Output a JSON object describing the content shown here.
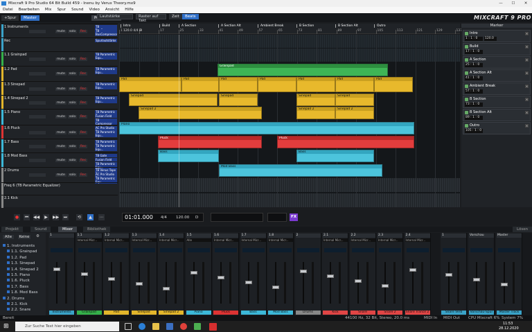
{
  "window": {
    "title": "Mixcraft 9 Pro Studio 64 Bit Build 459 - Inenu by Verux Theory.mx9"
  },
  "menu": [
    "Datei",
    "Bearbeiten",
    "Mix",
    "Spur",
    "Sound",
    "Video",
    "Ansicht",
    "Hilfe"
  ],
  "toolbar": {
    "volume_dd": "Lautstärke",
    "snap_dd": "Raster auf Takt",
    "time_btn": "Zeit",
    "beats_btn": "Beats",
    "logo": "MIXCRAFT 9 PRO"
  },
  "trackhdr": {
    "add_btn": "+Spur",
    "master_btn": "Master",
    "perf_btn": "Performance"
  },
  "ruler": {
    "ticks": [
      "1",
      "9",
      "17",
      "25",
      "33",
      "41",
      "49",
      "57",
      "65",
      "73",
      "81",
      "89",
      "97",
      "105",
      "113",
      "121",
      "129",
      "137"
    ],
    "markers": [
      "Intro",
      "Build",
      "A Section",
      "A Section Alt",
      "Ambient Break",
      "B Section",
      "B Section Alt",
      "Outro"
    ],
    "tempo": "120.0 4/4 B"
  },
  "tracks": [
    {
      "name": "1 Instruments",
      "fx": [
        "TB BusCompressor",
        "TB BusCompressor"
      ],
      "color": "#3aa3c8"
    },
    {
      "name": "Rec",
      "fx": [
        "Spurlautstärke"
      ],
      "color": "#3aa3c8"
    },
    {
      "name": "1.1 Grainpad",
      "fx": [
        "TB Parametric Equ..."
      ],
      "color": "#35b04a"
    },
    {
      "name": "1.2 Pad",
      "fx": [
        "TB Parametric Equ..."
      ],
      "color": "#e2b52b"
    },
    {
      "name": "1.3 Sinepad",
      "fx": [
        "TB Parametric Equ..."
      ],
      "color": "#e2b52b"
    },
    {
      "name": "1.4 Sinepad 2",
      "fx": [
        "TB Parametric Equ..."
      ],
      "color": "#e2b52b"
    },
    {
      "name": "1.5 Piano",
      "fx": [
        "TB Parametric Equ...",
        "Fusion Field",
        "TB Compressor"
      ],
      "color": "#3cb8d8"
    },
    {
      "name": "1.6 Pluck",
      "fx": [
        "AC Pro Studio Reve...",
        "TB Parametric Equ..."
      ],
      "color": "#d33"
    },
    {
      "name": "1.7 Bass",
      "fx": [
        "TB Parametric Equ...",
        "TB Parametric Equ..."
      ],
      "color": "#3cb8d8"
    },
    {
      "name": "1.8 Mod Bass",
      "fx": [
        "TB Gate",
        "Fusion Field",
        "TB Parametric Equ..."
      ],
      "color": "#3cb8d8"
    },
    {
      "name": "2 Drums",
      "fx": [
        "TB Venus Tape Emu...",
        "AC Pro Studio Reve...",
        "TB Parametric Equ..."
      ],
      "color": "#888"
    },
    {
      "name": "Freq 6 (TB Parametric Equalizer)",
      "fx": [],
      "color": "#888"
    },
    {
      "name": "2.1 Kick",
      "fx": [],
      "color": "#888"
    }
  ],
  "track_btns": {
    "mute": "mute",
    "solo": "solo",
    "rec": "Rec"
  },
  "clips": {
    "grainpad": "Grainpad",
    "pad": "Pad",
    "sinepad": "Sinepad",
    "sinepad2": "Sinepad 2",
    "piano": "Piano",
    "pluck": "Pluck",
    "bass": "Bass",
    "modbass": "Mod Bass"
  },
  "markers_panel": {
    "title": "Marker",
    "items": [
      {
        "name": "Intro",
        "val": "1 : 1 : 0",
        "tempo": "120.0"
      },
      {
        "name": "Build",
        "val": "17 : 1 : 0"
      },
      {
        "name": "A Section",
        "val": "25 : 1 : 0"
      },
      {
        "name": "A Section Alt",
        "val": "41 : 1 : 0"
      },
      {
        "name": "Ambient Break",
        "val": "57 : 1 : 0"
      },
      {
        "name": "B Section",
        "val": "73 : 1 : 0"
      },
      {
        "name": "B Section Alt",
        "val": "89 : 1 : 0"
      },
      {
        "name": "Outro",
        "val": "105 : 1 : 0"
      }
    ]
  },
  "transport": {
    "time": "01:01.000",
    "sig": "4/4",
    "tempo": "120.00",
    "key": "D",
    "fx": "FX"
  },
  "tabs": {
    "project": "Projekt",
    "sound": "Sound",
    "mixer": "Mixer",
    "bibliothek": "Bibliothek",
    "leave": "Lösen"
  },
  "browser": {
    "all": "Alle",
    "none": "Keine",
    "items": [
      "1. Instruments",
      "1.1. Grainpad",
      "1.2. Pad",
      "1.3. Sinepad",
      "1.4. Sinepad 2",
      "1.5. Piano",
      "1.6. Pluck",
      "1.7. Bass",
      "1.8. Mod Bass",
      "2. Drums",
      "2.1. Kick",
      "2.2. Snare"
    ]
  },
  "mixer": {
    "strips": [
      {
        "hd": "1",
        "fx": "",
        "lbl": "Instruments",
        "c": "#3aa3c8"
      },
      {
        "hd": "1.1",
        "fx": "Internal Micr...",
        "lbl": "Grainpad",
        "c": "#35b04a"
      },
      {
        "hd": "1.2",
        "fx": "Internal Micr...",
        "lbl": "Pad",
        "c": "#e2b52b"
      },
      {
        "hd": "1.3",
        "fx": "Internal Micr...",
        "lbl": "Sinepad",
        "c": "#e2b52b"
      },
      {
        "hd": "1.4",
        "fx": "Internal Micr...",
        "lbl": "Sinepad 2",
        "c": "#e2b52b"
      },
      {
        "hd": "1.5",
        "fx": "Alle",
        "lbl": "Piano",
        "c": "#3cb8d8"
      },
      {
        "hd": "1.6",
        "fx": "Internal Micr...",
        "lbl": "Pluck",
        "c": "#d33"
      },
      {
        "hd": "1.7",
        "fx": "Internal Micr...",
        "lbl": "Bass",
        "c": "#3cb8d8"
      },
      {
        "hd": "1.8",
        "fx": "Internal Micr...",
        "lbl": "Mod Bass",
        "c": "#3cb8d8"
      },
      {
        "hd": "2",
        "fx": "",
        "lbl": "Drums",
        "c": "#888"
      },
      {
        "hd": "2.1",
        "fx": "Internal Micr...",
        "lbl": "Kick",
        "c": "#e04545"
      },
      {
        "hd": "2.2",
        "fx": "Internal Micr...",
        "lbl": "Snare",
        "c": "#e04545"
      },
      {
        "hd": "2.3",
        "fx": "Internal Micr...",
        "lbl": "Snare 2",
        "c": "#e04545"
      },
      {
        "hd": "2.4",
        "fx": "Internal Micr...",
        "lbl": "Snare Trance 2",
        "c": "#e04545"
      },
      {
        "hd": "1",
        "fx": "",
        "lbl": "Snare Verb",
        "c": "#3aa3c8"
      },
      {
        "hd": "Vorschau",
        "fx": "",
        "lbl": "Vorschau-Spur",
        "c": "#3aa3c8"
      },
      {
        "hd": "Master",
        "fx": "",
        "lbl": "Master Track",
        "c": "#3aa3c8"
      }
    ]
  },
  "status": {
    "left": "Bereit",
    "rate": "44100 Hz, 32 Bit, Stereo, 20.0 ms",
    "midi_in": "MIDI In",
    "midi_out": "MIDI Out",
    "cpu": "CPU Mixcraft 6%",
    "system": "System 7%"
  },
  "taskbar": {
    "search": "Zur Suche Text hier eingeben",
    "time": "11:53",
    "date": "28.12.2020"
  }
}
